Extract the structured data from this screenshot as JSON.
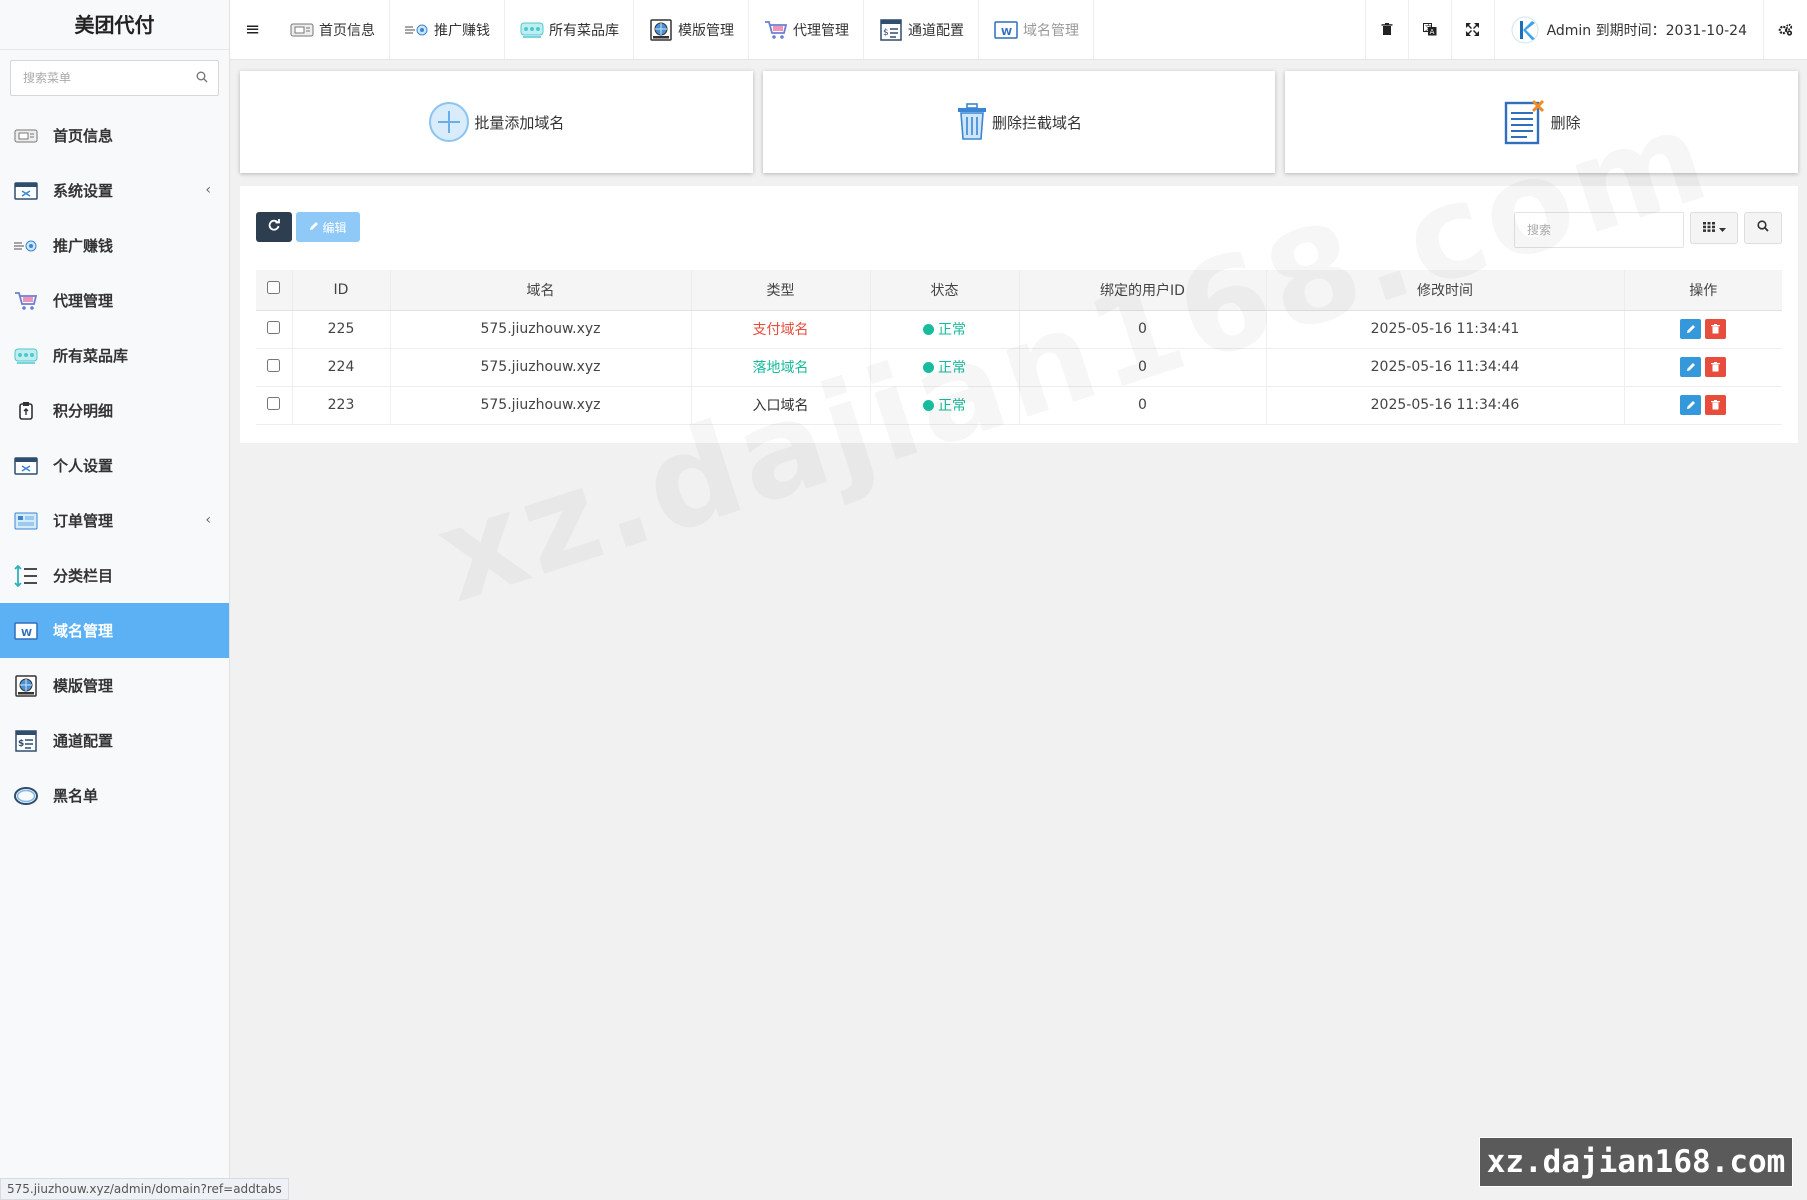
{
  "app": {
    "title": "美团代付"
  },
  "sidebar": {
    "search_placeholder": "搜索菜单",
    "items": [
      {
        "label": "首页信息",
        "icon": "home-info-icon",
        "has_arrow": false,
        "active": false
      },
      {
        "label": "系统设置",
        "icon": "system-settings-icon",
        "has_arrow": true,
        "active": false
      },
      {
        "label": "推广赚钱",
        "icon": "promotion-icon",
        "has_arrow": false,
        "active": false
      },
      {
        "label": "代理管理",
        "icon": "agent-cart-icon",
        "has_arrow": false,
        "active": false
      },
      {
        "label": "所有菜品库",
        "icon": "dish-library-icon",
        "has_arrow": false,
        "active": false
      },
      {
        "label": "积分明细",
        "icon": "points-detail-icon",
        "has_arrow": false,
        "active": false
      },
      {
        "label": "个人设置",
        "icon": "personal-settings-icon",
        "has_arrow": false,
        "active": false
      },
      {
        "label": "订单管理",
        "icon": "order-icon",
        "has_arrow": true,
        "active": false
      },
      {
        "label": "分类栏目",
        "icon": "category-icon",
        "has_arrow": false,
        "active": false
      },
      {
        "label": "域名管理",
        "icon": "domain-icon",
        "has_arrow": false,
        "active": true
      },
      {
        "label": "模版管理",
        "icon": "template-icon",
        "has_arrow": false,
        "active": false
      },
      {
        "label": "通道配置",
        "icon": "channel-config-icon",
        "has_arrow": false,
        "active": false
      },
      {
        "label": "黑名单",
        "icon": "blacklist-icon",
        "has_arrow": false,
        "active": false
      }
    ]
  },
  "topnav": {
    "tabs": [
      {
        "label": "首页信息",
        "icon": "home-info-icon",
        "active": false
      },
      {
        "label": "推广赚钱",
        "icon": "promotion-icon",
        "active": false
      },
      {
        "label": "所有菜品库",
        "icon": "dish-library-icon",
        "active": false
      },
      {
        "label": "模版管理",
        "icon": "template-icon",
        "active": false
      },
      {
        "label": "代理管理",
        "icon": "agent-cart-icon",
        "active": false
      },
      {
        "label": "通道配置",
        "icon": "channel-config-icon",
        "active": false
      },
      {
        "label": "域名管理",
        "icon": "domain-icon",
        "active": true
      }
    ],
    "user_text": "Admin 到期时间：2031-10-24"
  },
  "cards": [
    {
      "label": "批量添加域名",
      "icon": "add-circle-icon"
    },
    {
      "label": "删除拦截域名",
      "icon": "trash-can-icon"
    },
    {
      "label": "删除",
      "icon": "delete-document-icon"
    }
  ],
  "toolbar": {
    "edit_label": "编辑",
    "search_placeholder": "搜索"
  },
  "table": {
    "columns": [
      "ID",
      "域名",
      "类型",
      "状态",
      "绑定的用户ID",
      "修改时间",
      "操作"
    ],
    "rows": [
      {
        "id": "225",
        "domain": "575.jiuzhouw.xyz",
        "type": "支付域名",
        "type_color": "#e74c3c",
        "status": "正常",
        "user_id": "0",
        "time": "2025-05-16 11:34:41"
      },
      {
        "id": "224",
        "domain": "575.jiuzhouw.xyz",
        "type": "落地域名",
        "type_color": "#18bc9c",
        "status": "正常",
        "user_id": "0",
        "time": "2025-05-16 11:34:44"
      },
      {
        "id": "223",
        "domain": "575.jiuzhouw.xyz",
        "type": "入口域名",
        "type_color": "#333333",
        "status": "正常",
        "user_id": "0",
        "time": "2025-05-16 11:34:46"
      }
    ]
  },
  "statusbar": {
    "url": "575.jiuzhouw.xyz/admin/domain?ref=addtabs"
  },
  "watermark": {
    "text": "xz.dajian168.com"
  },
  "colors": {
    "accent": "#5bb1f4",
    "dark_button": "#2c3e50",
    "success": "#18bc9c",
    "danger": "#e74c3c",
    "primary": "#3498db"
  }
}
